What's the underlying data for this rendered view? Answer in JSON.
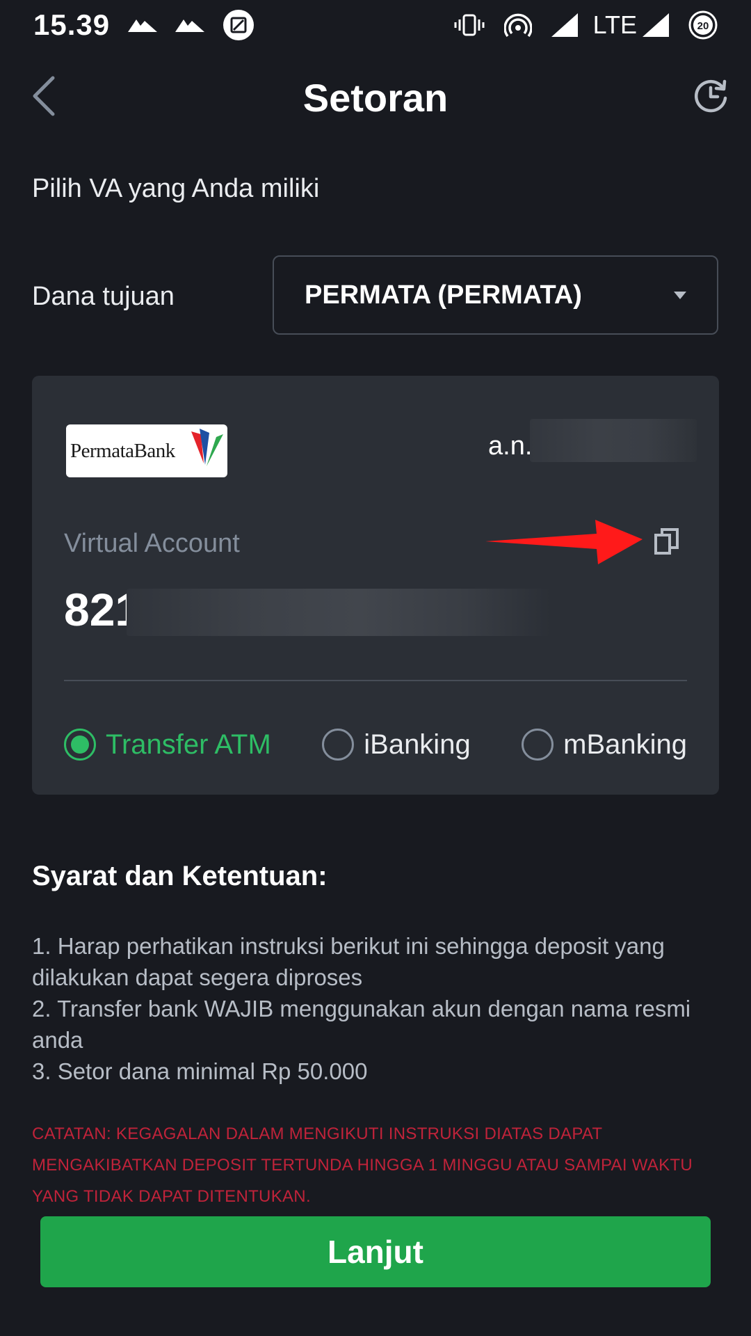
{
  "status_bar": {
    "time": "15.39",
    "network": "LTE",
    "battery_level": "20",
    "icons": [
      "mountain-icon",
      "mountain-icon",
      "screenshot-icon",
      "vibrate-icon",
      "hotspot-icon",
      "signal-icon",
      "battery-icon"
    ]
  },
  "header": {
    "title": "Setoran",
    "back_icon": "chevron-left-icon",
    "history_icon": "history-icon"
  },
  "form": {
    "instruction": "Pilih VA yang Anda miliki",
    "destination_label": "Dana tujuan",
    "destination_value": "PERMATA (PERMATA)"
  },
  "va_card": {
    "bank_logo_text": "PermataBank",
    "owner_prefix": "a.n.",
    "va_label": "Virtual Account",
    "va_number_visible": "821",
    "methods": [
      {
        "label": "Transfer ATM",
        "selected": true
      },
      {
        "label": "iBanking",
        "selected": false
      },
      {
        "label": "mBanking",
        "selected": false
      }
    ]
  },
  "terms": {
    "title": "Syarat dan Ketentuan:",
    "items": [
      "1. Harap perhatikan instruksi berikut ini sehingga deposit yang dilakukan dapat segera diproses",
      "2. Transfer bank WAJIB menggunakan akun dengan nama resmi anda",
      "3. Setor dana minimal Rp 50.000"
    ]
  },
  "note": "CATATAN: KEGAGALAN DALAM MENGIKUTI INSTRUKSI DIATAS DAPAT MENGAKIBATKAN DEPOSIT TERTUNDA HINGGA 1 MINGGU ATAU SAMPAI WAKTU YANG TIDAK DAPAT DITENTUKAN.",
  "continue_label": "Lanjut",
  "colors": {
    "background": "#181a20",
    "card": "#2b2f36",
    "accent_green": "#2ebd65",
    "button_green": "#1fa54b",
    "note_red": "#c0233a",
    "arrow_red": "#ff1a1a"
  }
}
